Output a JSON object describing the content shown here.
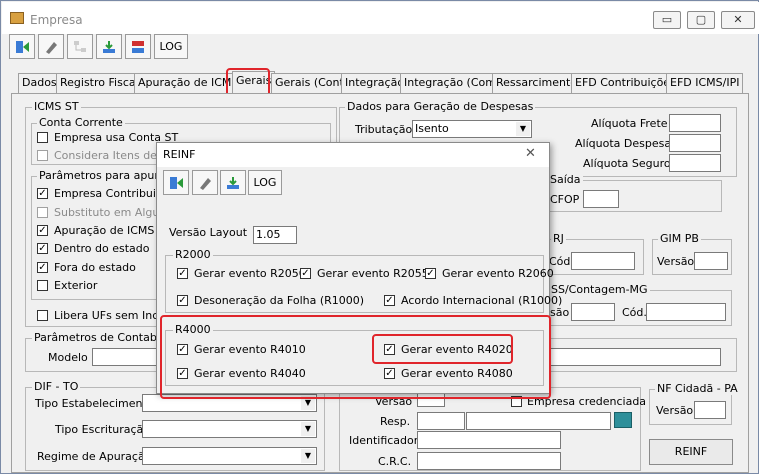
{
  "window": {
    "title": "Empresa",
    "minimize": "▭",
    "maximize": "▢",
    "close": "✕"
  },
  "toolbar": {
    "log_label": "LOG"
  },
  "tabs": [
    "Dados",
    "Registro Fiscal",
    "Apuração de ICMS",
    "Gerais",
    "Gerais (Cont.)",
    "Integração",
    "Integração (Com.)",
    "Ressarcimento",
    "EFD Contribuições",
    "EFD ICMS/IPI"
  ],
  "icms_st": {
    "title": "ICMS ST",
    "conta_corrente": {
      "title": "Conta Corrente",
      "items": [
        {
          "label": "Empresa usa Conta ST",
          "checked": false,
          "disabled": false
        },
        {
          "label": "Considera Itens de No",
          "checked": false,
          "disabled": true
        }
      ]
    },
    "parametros": {
      "title": "Parâmetros para apuraçã",
      "items": [
        {
          "label": "Empresa Contribuinte",
          "checked": true,
          "disabled": false
        },
        {
          "label": "Substituto em Alguma",
          "checked": false,
          "disabled": true
        },
        {
          "label": "Apuração de ICMS ST",
          "checked": true,
          "disabled": false
        },
        {
          "label": "Dentro do estado",
          "checked": true,
          "disabled": false
        },
        {
          "label": "Fora do estado",
          "checked": true,
          "disabled": false
        },
        {
          "label": "Exterior",
          "checked": false,
          "disabled": false
        }
      ]
    },
    "libera": {
      "label": "Libera UFs sem Incriç",
      "checked": false
    }
  },
  "contabil": {
    "title": "Parâmetros de Contabiliz",
    "modelo_label": "Modelo"
  },
  "dif_to": {
    "title": "DIF - TO",
    "fields": [
      "Tipo Estabelecimento",
      "Tipo Escrituração",
      "Regime de Apuração"
    ]
  },
  "despesas": {
    "title": "Dados para Geração de Despesas",
    "tributacao_label": "Tributação",
    "tributacao_value": "Isento",
    "aliquota_frete": "Alíquota Frete",
    "aliquota_despesa": "Alíquota Despesa",
    "aliquota_seguro": "Alíquota Seguro"
  },
  "saida": {
    "title": "Saída",
    "cfop": "CFOP"
  },
  "rj": {
    "title": "RJ",
    "cod": "Cód."
  },
  "gim_pb": {
    "title": "GIM PB",
    "versao": "Versão"
  },
  "iss_contagem": {
    "title": "SS/Contagem-MG",
    "versao": "são",
    "cod": "Cód."
  },
  "lower_right": {
    "versao": "Versão",
    "empresa_credenciada": "Empresa credenciada",
    "resp": "Resp.",
    "identificador": "Identificador",
    "crc": "C.R.C."
  },
  "nf_cidada": {
    "title": "NF Cidadã - PA",
    "versao": "Versão"
  },
  "reinf_button": "REINF",
  "reinf_dialog": {
    "title": "REINF",
    "close": "✕",
    "log_label": "LOG",
    "versao_layout_label": "Versão Layout",
    "versao_layout_value": "1.05",
    "r2000": {
      "title": "R2000",
      "items": [
        {
          "label": "Gerar evento R2050",
          "checked": true
        },
        {
          "label": "Gerar evento R2055",
          "checked": true
        },
        {
          "label": "Gerar evento R2060",
          "checked": true
        },
        {
          "label": "Desoneração da Folha (R1000)",
          "checked": true
        },
        {
          "label": "Acordo Internacional (R1000)",
          "checked": true
        }
      ]
    },
    "r4000": {
      "title": "R4000",
      "items": [
        {
          "label": "Gerar evento R4010",
          "checked": true
        },
        {
          "label": "Gerar evento R4020",
          "checked": true
        },
        {
          "label": "Gerar evento R4040",
          "checked": true
        },
        {
          "label": "Gerar evento R4080",
          "checked": true
        }
      ]
    }
  },
  "colors": {
    "highlight": "#e0252b",
    "titlebar": "#ffffff",
    "panel": "#f0f0f0"
  }
}
